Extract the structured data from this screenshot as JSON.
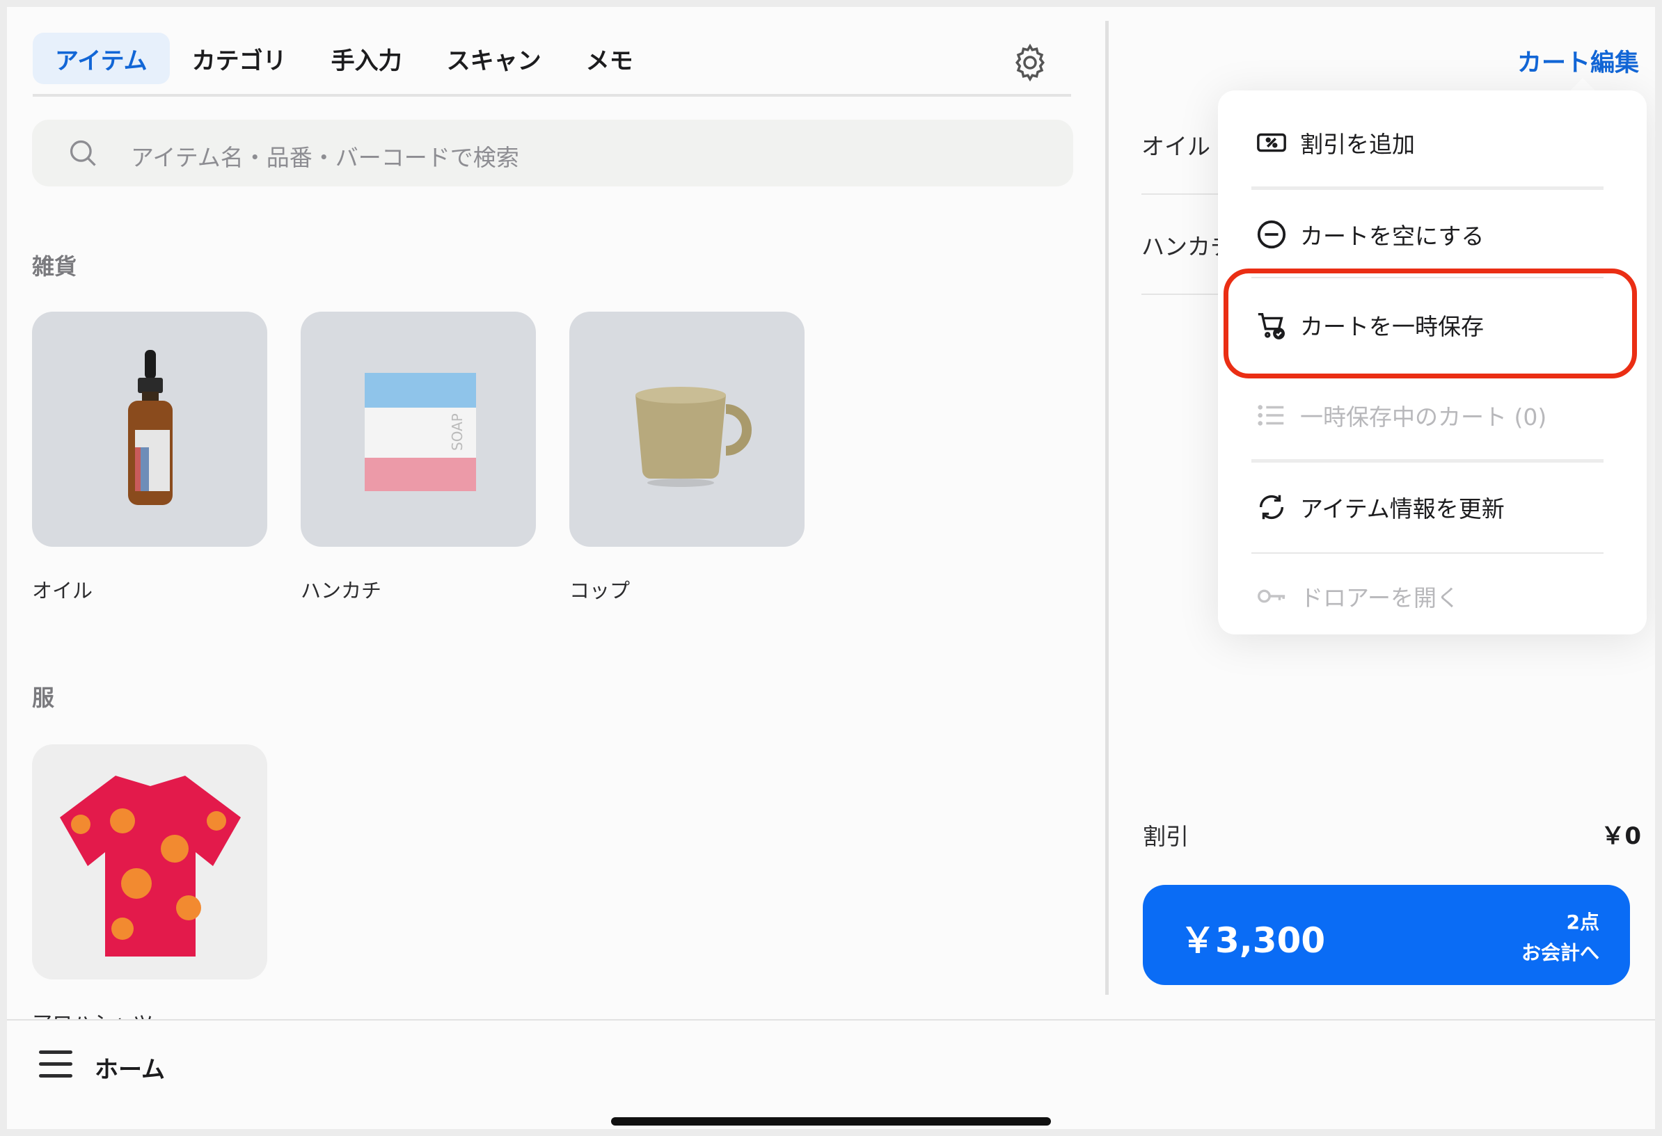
{
  "tabs": [
    {
      "label": "アイテム",
      "active": true
    },
    {
      "label": "カテゴリ"
    },
    {
      "label": "手入力"
    },
    {
      "label": "スキャン"
    },
    {
      "label": "メモ"
    }
  ],
  "search": {
    "placeholder": "アイテム名・品番・バーコードで検索"
  },
  "sections": [
    {
      "title": "雑貨",
      "items": [
        {
          "name": "オイル",
          "icon": "oil-bottle"
        },
        {
          "name": "ハンカチ",
          "icon": "soap-towel"
        },
        {
          "name": "コップ",
          "icon": "cup"
        }
      ]
    },
    {
      "title": "服",
      "items": [
        {
          "name": "アロハシャツ",
          "icon": "aloha-shirt"
        }
      ]
    }
  ],
  "cart": {
    "edit_label": "カート編集",
    "lines": [
      "オイル",
      "ハンカチ"
    ],
    "discount_label": "割引",
    "discount_value": "￥0",
    "total": "￥3,300",
    "count": "2点",
    "checkout_label": "お会計へ"
  },
  "menu": {
    "items": [
      {
        "label": "割引を追加",
        "icon": "discount-ticket-icon",
        "enabled": true
      },
      {
        "label": "カートを空にする",
        "icon": "minus-circle-icon",
        "enabled": true
      },
      {
        "label": "カートを一時保存",
        "icon": "cart-save-icon",
        "enabled": true,
        "highlighted": true
      },
      {
        "label": "一時保存中のカート (0)",
        "icon": "list-icon",
        "enabled": false
      },
      {
        "label": "アイテム情報を更新",
        "icon": "refresh-icon",
        "enabled": true
      },
      {
        "label": "ドロアーを開く",
        "icon": "key-icon",
        "enabled": false
      }
    ]
  },
  "bottom": {
    "home_label": "ホーム"
  },
  "colors": {
    "accent": "#0a6cf5",
    "highlight": "#ea2e14",
    "tab_active_bg": "#e7f0fb"
  }
}
